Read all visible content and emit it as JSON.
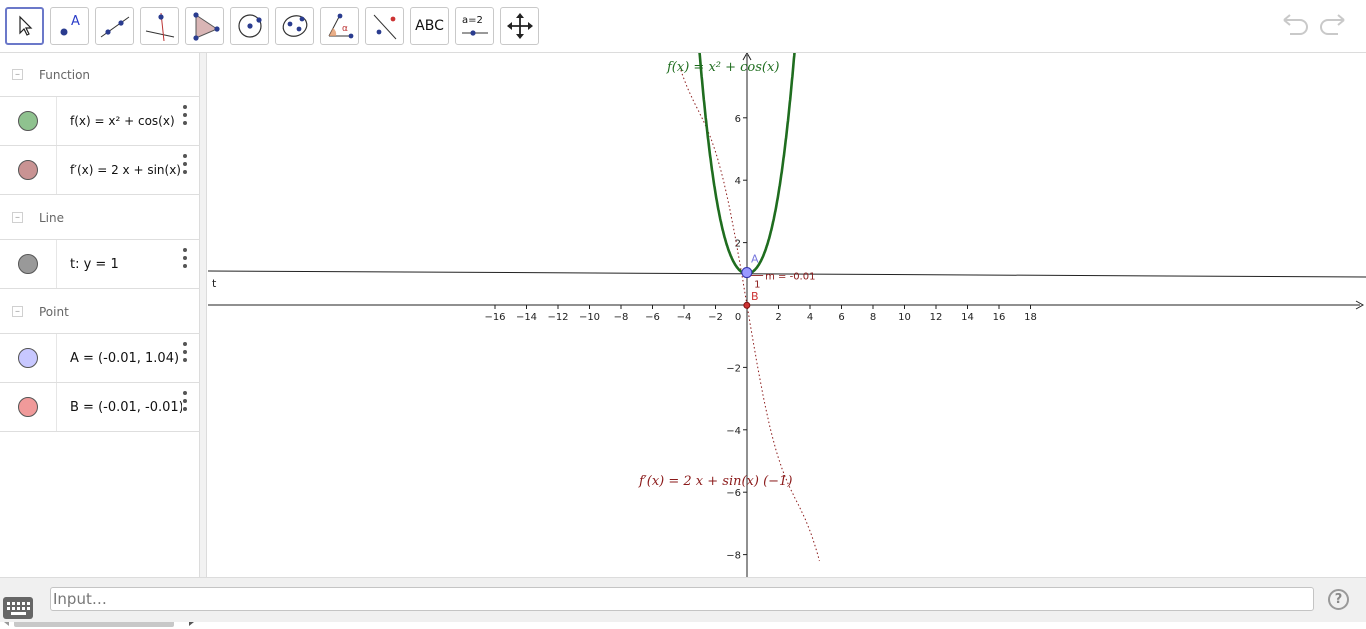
{
  "toolbar": {
    "tools": [
      {
        "name": "move-tool",
        "icon": "arrow-cursor-icon"
      },
      {
        "name": "point-tool",
        "icon": "point-icon",
        "label": "A"
      },
      {
        "name": "line-tool",
        "icon": "line-through-points-icon"
      },
      {
        "name": "perpendicular-line-tool",
        "icon": "perpendicular-icon"
      },
      {
        "name": "polygon-tool",
        "icon": "polygon-icon"
      },
      {
        "name": "circle-tool",
        "icon": "circle-center-point-icon"
      },
      {
        "name": "conic-tool",
        "icon": "ellipse-icon"
      },
      {
        "name": "angle-tool",
        "icon": "angle-icon",
        "label": "α"
      },
      {
        "name": "reflect-tool",
        "icon": "reflect-icon"
      },
      {
        "name": "text-tool",
        "icon": "text-icon",
        "label": "ABC"
      },
      {
        "name": "slider-tool",
        "icon": "slider-icon",
        "label": "a=2"
      },
      {
        "name": "move-view-tool",
        "icon": "move-graphics-icon"
      }
    ],
    "undo_icon": "undo-icon",
    "redo_icon": "redo-icon"
  },
  "algebra": {
    "groups": [
      {
        "label": "Function",
        "items": [
          {
            "definition": "f(x) = x² + cos(x)",
            "color": "#8fc28f"
          },
          {
            "definition": "f′(x) = 2 x + sin(x) (−",
            "color": "#c99393"
          }
        ]
      },
      {
        "label": "Line",
        "items": [
          {
            "definition": "t: y = 1",
            "color": "#999999"
          }
        ]
      },
      {
        "label": "Point",
        "items": [
          {
            "definition": "A = (-0.01, 1.04)",
            "color": "#c8c8ff"
          },
          {
            "definition": "B = (-0.01, -0.01)",
            "color": "#f09a9a"
          }
        ]
      }
    ]
  },
  "graphics": {
    "x_ticks": [
      "−16",
      "−14",
      "−12",
      "−10",
      "−8",
      "−6",
      "−4",
      "−2",
      "0",
      "2",
      "4",
      "6",
      "8",
      "10",
      "12",
      "14",
      "16",
      "18"
    ],
    "y_ticks": [
      "6",
      "4",
      "2",
      "−2",
      "−4",
      "−6",
      "−8"
    ],
    "f_label": "f(x)  =  x² + cos(x)",
    "fprime_label": "f′(x)  =  2 x + sin(x) (−1)",
    "line_label": "t",
    "point_a_label": "A",
    "point_b_label": "B",
    "slope_label": "m = -0.01",
    "slope_run": "1",
    "colors": {
      "f": "#1f6d1f",
      "fprime": "#8b1a1a",
      "point_a": "#9999ff",
      "point_b": "#cc3333",
      "line": "#222222"
    }
  },
  "input": {
    "placeholder": "Input…"
  },
  "help_label": "?"
}
